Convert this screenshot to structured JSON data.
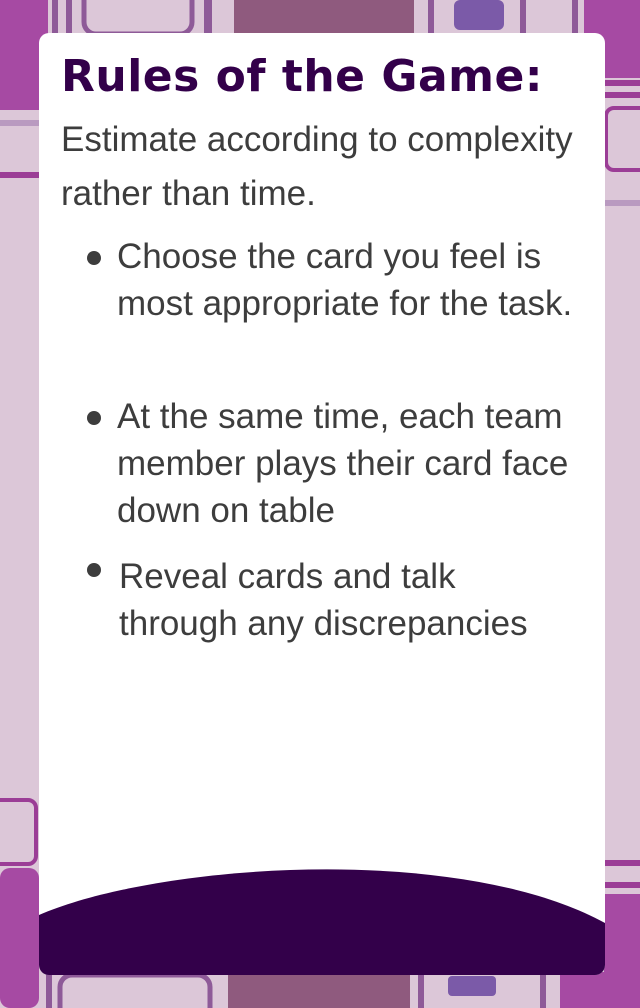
{
  "card": {
    "title": "Rules of the Game:",
    "intro": "Estimate according to complexity rather than time.",
    "rules": [
      "Choose the card you feel is most appropriate for the task.",
      "At the same time, each team member plays their card face down on table",
      "Reveal cards and talk through any discrepancies"
    ]
  },
  "colors": {
    "title": "#33004a",
    "text": "#3d3d3d",
    "footer": "#33004a",
    "background": "#dcc7d8",
    "accent": "#9b3d96"
  }
}
